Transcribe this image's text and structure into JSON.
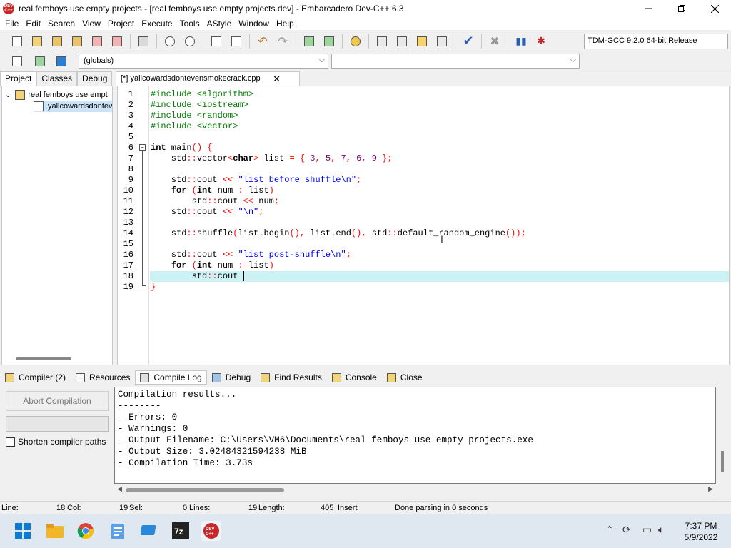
{
  "window": {
    "title": "real femboys use empty projects - [real femboys use empty projects.dev] - Embarcadero Dev-C++ 6.3",
    "app_icon_text": "DEV C++"
  },
  "menu": [
    "File",
    "Edit",
    "Search",
    "View",
    "Project",
    "Execute",
    "Tools",
    "AStyle",
    "Window",
    "Help"
  ],
  "toolbar": {
    "compiler": "TDM-GCC 9.2.0 64-bit Release",
    "scope": "(globals)"
  },
  "left_panel": {
    "tabs": [
      "Project",
      "Classes",
      "Debug"
    ],
    "tree_root": "real femboys use empt",
    "tree_child": "yallcowardsdontev"
  },
  "editor": {
    "tab_label": "[*] yallcowardsdontevensmokecrack.cpp",
    "line_numbers": [
      "1",
      "2",
      "3",
      "4",
      "5",
      "6",
      "7",
      "8",
      "9",
      "10",
      "11",
      "12",
      "13",
      "14",
      "15",
      "16",
      "17",
      "18",
      "19"
    ]
  },
  "bottom_tabs": [
    "Compiler (2)",
    "Resources",
    "Compile Log",
    "Debug",
    "Find Results",
    "Console",
    "Close"
  ],
  "compile_panel": {
    "abort_label": "Abort Compilation",
    "shorten_label": "Shorten compiler paths",
    "log": [
      "Compilation results...",
      "--------",
      "- Errors: 0",
      "- Warnings: 0",
      "- Output Filename: C:\\Users\\VM6\\Documents\\real femboys use empty projects.exe",
      "- Output Size: 3.02484321594238 MiB",
      "- Compilation Time: 3.73s"
    ]
  },
  "status": {
    "line_label": "Line:",
    "line_value": "18",
    "col_label": "Col:",
    "col_value": "19",
    "sel_label": "Sel:",
    "sel_value": "0",
    "lines_label": "Lines:",
    "lines_value": "19",
    "length_label": "Length:",
    "length_value": "405",
    "mode": "Insert",
    "message": "Done parsing in 0 seconds"
  },
  "taskbar": {
    "time": "7:37 PM",
    "date": "5/9/2022",
    "icons": [
      "windows-start-icon",
      "file-explorer-icon",
      "chrome-icon",
      "notepad-icon",
      "remote-desktop-icon",
      "7zip-icon",
      "devcpp-icon"
    ]
  }
}
